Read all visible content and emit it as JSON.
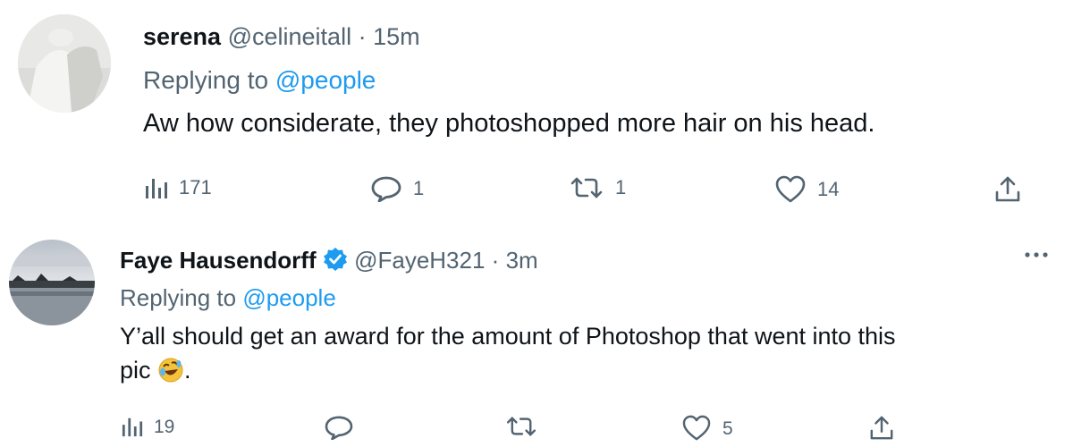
{
  "tweets": [
    {
      "display_name": "serena",
      "handle": "@celineitall",
      "separator": "·",
      "time": "15m",
      "replying_prefix": "Replying to",
      "replying_to": "@people",
      "text": "Aw how considerate, they photoshopped more hair on his head.",
      "stats": {
        "views": "171",
        "replies": "1",
        "retweets": "1",
        "likes": "14"
      }
    },
    {
      "display_name": "Faye Hausendorff",
      "verified": true,
      "handle": "@FayeH321",
      "separator": "·",
      "time": "3m",
      "replying_prefix": "Replying to",
      "replying_to": "@people",
      "text_line1": "Y’all should get an award for the amount of Photoshop that went into this",
      "text_line2_start": "pic",
      "text_line2_end": ".",
      "emoji": "rolling-on-floor-laughing",
      "stats": {
        "views": "19",
        "replies": "",
        "retweets": "",
        "likes": "5"
      }
    }
  ],
  "icons": {
    "views": "bar-chart-icon",
    "reply": "speech-bubble-icon",
    "retweet": "retweet-icon",
    "like": "heart-icon",
    "share": "share-icon",
    "more": "more-dots-icon",
    "verified": "verified-badge-icon"
  },
  "colors": {
    "text": "#0f1419",
    "muted": "#536471",
    "accent": "#1d9bf0"
  }
}
